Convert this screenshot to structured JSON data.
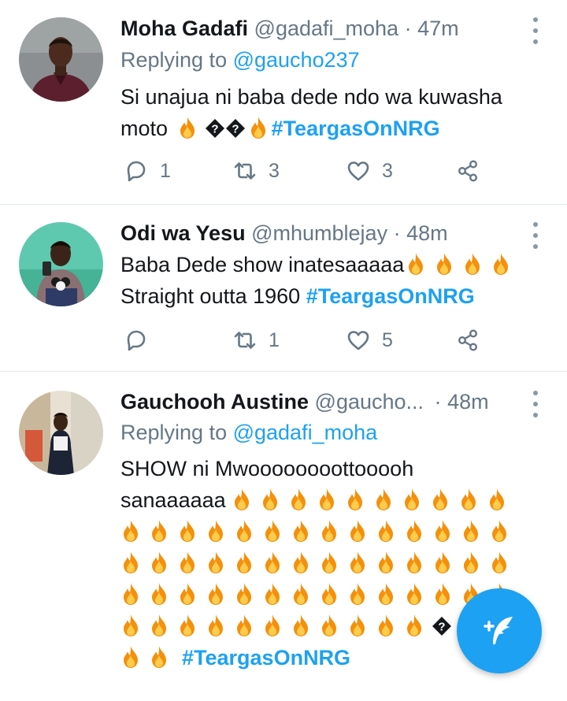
{
  "tweets": [
    {
      "name": "Moha Gadafi",
      "handle": "@gadafi_moha",
      "time": "47m",
      "replying_prefix": "Replying to ",
      "replying_to": "@gaucho237",
      "text_line1": "Si unajua ni baba dede ndo wa kuwasha",
      "text_line2": "moto",
      "hashtag": "#TeargasOnNRG",
      "replies": "1",
      "retweets": "3",
      "likes": "3"
    },
    {
      "name": "Odi wa Yesu",
      "handle": "@mhumblejay",
      "time": "48m",
      "text_line1": "Baba Dede show inatesaaaaa",
      "text_line2": "Straight outta 1960",
      "hashtag": "#TeargasOnNRG",
      "replies": "",
      "retweets": "1",
      "likes": "5"
    },
    {
      "name": "Gauchooh Austine",
      "handle": "@gaucho...",
      "time": "48m",
      "replying_prefix": "Replying to ",
      "replying_to": "@gadafi_moha",
      "text_line1": "SHOW ni Mwoooooooottooooh",
      "text_line2": "sanaaaaaa",
      "hashtag": "#TeargasOnNRG"
    }
  ],
  "icons": {
    "reply": "reply-icon",
    "retweet": "retweet-icon",
    "like": "heart-icon",
    "share": "share-icon",
    "more": "more-vertical-icon",
    "emoji": "fire-emoji",
    "compose": "compose-tweet-icon"
  },
  "colors": {
    "accent": "#1da1f2",
    "secondary_text": "#657786",
    "divider": "#e1e8ed"
  }
}
